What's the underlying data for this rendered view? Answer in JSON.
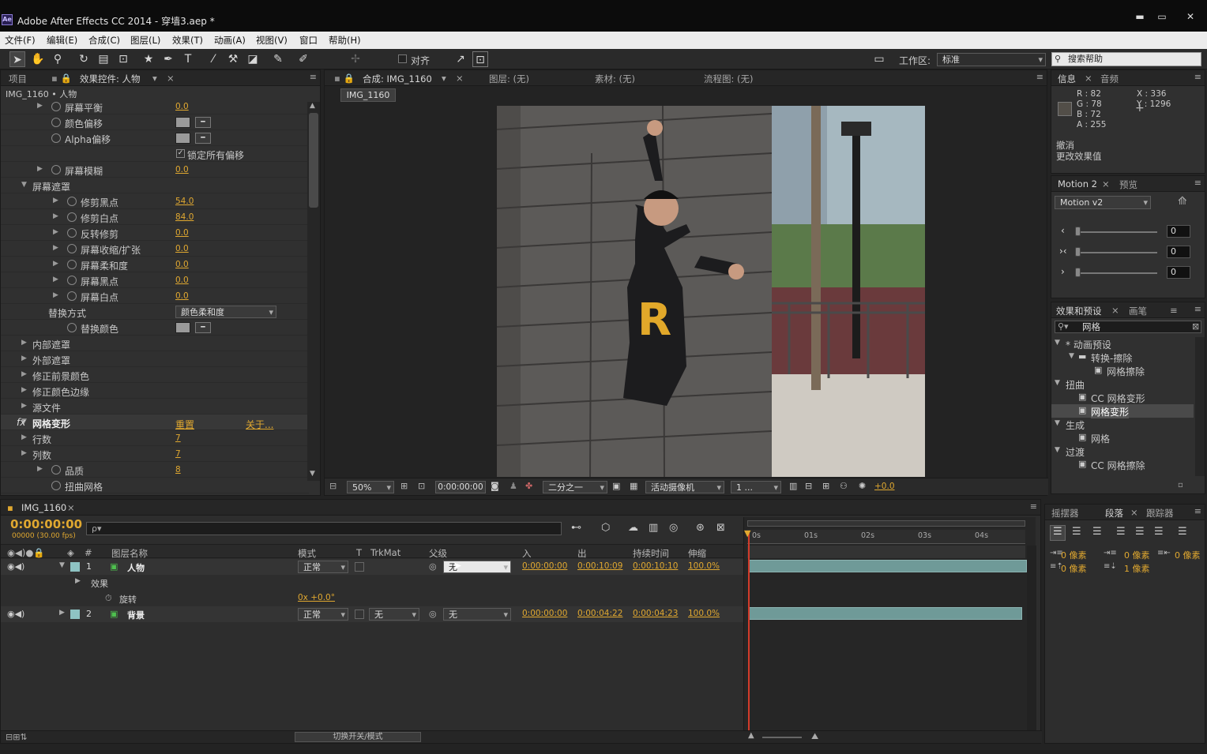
{
  "window": {
    "title": "Adobe After Effects CC 2014 - 穿墙3.aep *",
    "logo": "Ae",
    "minimize": "▬",
    "maximize": "▭",
    "close": "✕"
  },
  "menu": [
    "文件(F)",
    "编辑(E)",
    "合成(C)",
    "图层(L)",
    "效果(T)",
    "动画(A)",
    "视图(V)",
    "窗口",
    "帮助(H)"
  ],
  "toolbar": {
    "snap_label": "对齐",
    "workspace_label": "工作区:",
    "workspace_value": "标准",
    "search_placeholder": "搜索帮助"
  },
  "effect_controls": {
    "tab_project": "项目",
    "tab_effect": "效果控件: 人物",
    "breadcrumb": "IMG_1160 • 人物",
    "rows": [
      {
        "label": "屏幕平衡",
        "value": "0.0"
      },
      {
        "label": "颜色偏移"
      },
      {
        "label": "Alpha偏移"
      },
      {
        "label": "锁定所有偏移"
      },
      {
        "label": "屏幕模糊",
        "value": "0.0"
      },
      {
        "label": "屏幕遮罩"
      },
      {
        "label": "修剪黑点",
        "value": "54.0"
      },
      {
        "label": "修剪白点",
        "value": "84.0"
      },
      {
        "label": "反转修剪",
        "value": "0.0"
      },
      {
        "label": "屏幕收缩/扩张",
        "value": "0.0"
      },
      {
        "label": "屏幕柔和度",
        "value": "0.0"
      },
      {
        "label": "屏幕黑点",
        "value": "0.0"
      },
      {
        "label": "屏幕白点",
        "value": "0.0"
      },
      {
        "label": "替换方式",
        "value": "颜色柔和度"
      },
      {
        "label": "替换颜色"
      },
      {
        "label": "内部遮罩"
      },
      {
        "label": "外部遮罩"
      },
      {
        "label": "修正前景颜色"
      },
      {
        "label": "修正颜色边缘"
      },
      {
        "label": "源文件"
      },
      {
        "label": "网格变形",
        "reset": "重置",
        "about": "关于..."
      },
      {
        "label": "行数",
        "value": "7"
      },
      {
        "label": "列数",
        "value": "7"
      },
      {
        "label": "品质",
        "value": "8"
      },
      {
        "label": "扭曲网格"
      }
    ]
  },
  "composition": {
    "tab": "合成: IMG_1160",
    "tab_layer": "图层: (无)",
    "tab_footage": "素材: (无)",
    "tab_flow": "流程图: (无)",
    "subtab": "IMG_1160",
    "zoom": "50%",
    "timecode": "0:00:00:00",
    "resolution": "二分之一",
    "camera": "活动摄像机",
    "views": "1 ...",
    "exposure": "+0.0"
  },
  "info": {
    "tab_info": "信息",
    "tab_audio": "音频",
    "r": "R : 82",
    "g": "G : 78",
    "b": "B : 72",
    "a": "A : 255",
    "x": "X : 336",
    "y": "Y : 1296",
    "undo": "撤消",
    "undo_detail": "更改效果值"
  },
  "motion": {
    "tab": "Motion 2",
    "tab_preview": "预览",
    "preset": "Motion v2",
    "values": [
      "0",
      "0",
      "0"
    ],
    "icons": [
      "‹",
      "›‹",
      "›"
    ]
  },
  "effects_presets": {
    "tab": "效果和预设",
    "tab_brush": "画笔",
    "tab_more": "≡",
    "search": "网格",
    "items": [
      {
        "label": "* 动画预设",
        "level": 0
      },
      {
        "label": "转换-擦除",
        "level": 1
      },
      {
        "label": "网格擦除",
        "level": 2
      },
      {
        "label": "扭曲",
        "level": 0
      },
      {
        "label": "CC 网格变形",
        "level": 1
      },
      {
        "label": "网格变形",
        "level": 1,
        "selected": true
      },
      {
        "label": "生成",
        "level": 0
      },
      {
        "label": "网格",
        "level": 1
      },
      {
        "label": "过渡",
        "level": 0
      },
      {
        "label": "CC 网格擦除",
        "level": 1
      }
    ]
  },
  "paragraph": {
    "tab_wiggler": "摇摆器",
    "tab_paragraph": "段落",
    "tab_tracker": "跟踪器",
    "fields": [
      "0 像素",
      "0 像素",
      "0 像素",
      "0 像素",
      "1 像素"
    ]
  },
  "timeline": {
    "tab": "IMG_1160",
    "timecode": "0:00:00:00",
    "fps": "00000 (30.00 fps)",
    "search_placeholder": "ρ▾",
    "columns": {
      "num": "#",
      "name": "图层名称",
      "mode": "模式",
      "t": "T",
      "trkmat": "TrkMat",
      "parent": "父级",
      "in": "入",
      "out": "出",
      "dur": "持续时间",
      "stretch": "伸缩"
    },
    "ruler": [
      "0s",
      "01s",
      "02s",
      "03s",
      "04s"
    ],
    "layers": [
      {
        "num": "1",
        "name": "人物",
        "mode": "正常",
        "trkmat": "",
        "parent": "无",
        "in": "0:00:00:00",
        "out": "0:00:10:09",
        "dur": "0:00:10:10",
        "stretch": "100.0%"
      },
      {
        "num": "2",
        "name": "背景",
        "mode": "正常",
        "trkmat": "无",
        "parent": "无",
        "in": "0:00:00:00",
        "out": "0:00:04:22",
        "dur": "0:00:04:23",
        "stretch": "100.0%"
      }
    ],
    "effects_label": "效果",
    "rotation_label": "旋转",
    "rotation_value": "0x +0.0°",
    "toggle_label": "切换开关/模式"
  },
  "colors": {
    "accent": "#e0a830",
    "panel": "#303030",
    "clip": "#6f9a98",
    "playhead": "#d23b2a"
  }
}
